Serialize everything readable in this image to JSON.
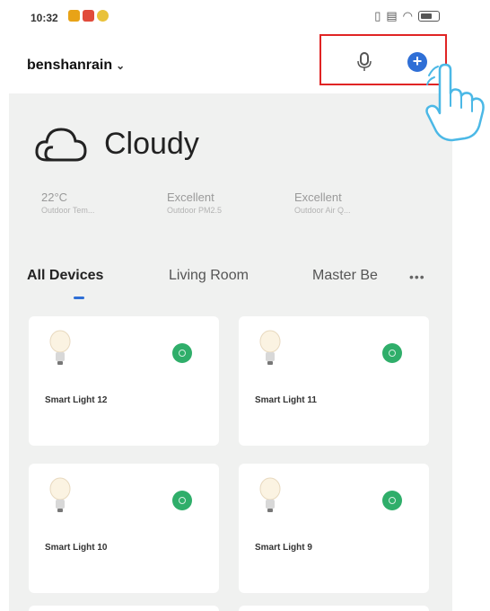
{
  "status_bar": {
    "time": "10:32"
  },
  "header": {
    "account_name": "benshanrain"
  },
  "weather": {
    "condition": "Cloudy",
    "stats": [
      {
        "value": "22°C",
        "label": "Outdoor Tem..."
      },
      {
        "value": "Excellent",
        "label": "Outdoor PM2.5"
      },
      {
        "value": "Excellent",
        "label": "Outdoor Air Q..."
      }
    ]
  },
  "tabs": [
    {
      "label": "All Devices",
      "active": true
    },
    {
      "label": "Living Room",
      "active": false
    },
    {
      "label": "Master Be",
      "active": false
    }
  ],
  "more_label": "•••",
  "devices": [
    {
      "name": "Smart Light 12"
    },
    {
      "name": "Smart Light 11"
    },
    {
      "name": "Smart Light 10"
    },
    {
      "name": "Smart Light 9"
    }
  ],
  "colors": {
    "accent": "#2f6fd6",
    "power_on": "#2fae6a",
    "highlight": "#e02424"
  }
}
